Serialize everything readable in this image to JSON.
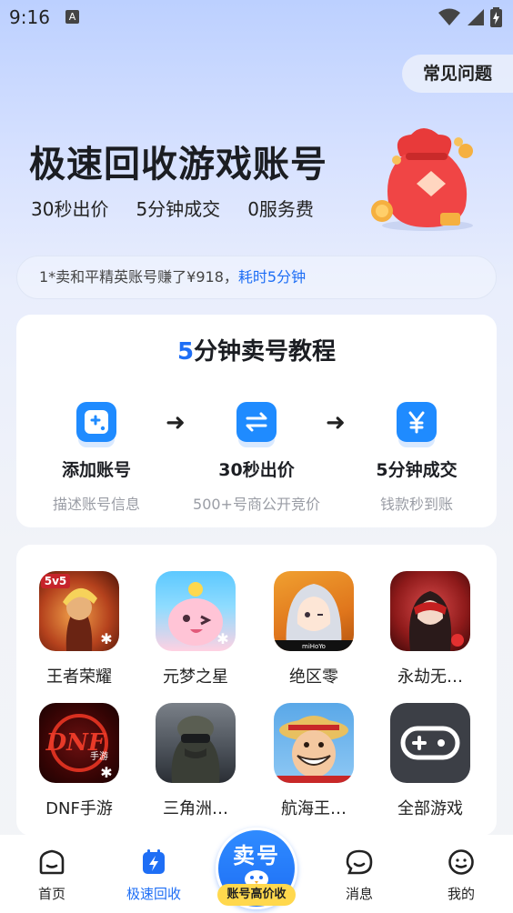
{
  "status": {
    "time": "9:16",
    "indicator": "A"
  },
  "faq_label": "常见问题",
  "hero": {
    "title": "极速回收游戏账号",
    "features": [
      "30秒出价",
      "5分钟成交",
      "0服务费"
    ]
  },
  "ticker": {
    "text": "1*卖和平精英账号赚了¥918，",
    "highlight": "耗时5分钟"
  },
  "tutorial": {
    "title_num": "5",
    "title_rest": "分钟卖号教程",
    "steps": [
      {
        "title": "添加账号",
        "desc": "描述账号信息",
        "icon": "add-icon"
      },
      {
        "title": "30秒出价",
        "desc": "500+号商公开竞价",
        "icon": "swap-icon"
      },
      {
        "title": "5分钟成交",
        "desc": "钱款秒到账",
        "icon": "yen-icon"
      }
    ],
    "arrow": "➜"
  },
  "games": [
    {
      "name": "王者荣耀",
      "badge": "5v5"
    },
    {
      "name": "元梦之星"
    },
    {
      "name": "绝区零",
      "badge": "miHoYo"
    },
    {
      "name": "永劫无…"
    },
    {
      "name": "DNF手游",
      "badge": "手游"
    },
    {
      "name": "三角洲…"
    },
    {
      "name": "航海王…"
    },
    {
      "name": "全部游戏"
    }
  ],
  "tabbar": {
    "tabs": [
      {
        "label": "首页",
        "icon": "home-icon"
      },
      {
        "label": "极速回收",
        "icon": "lightning-icon",
        "active": true
      },
      {
        "label": "消息",
        "icon": "message-icon"
      },
      {
        "label": "我的",
        "icon": "profile-icon"
      }
    ],
    "sell_label": "卖号",
    "sell_badge": "账号高价收"
  },
  "colors": {
    "accent": "#1e6ef5",
    "icon_blue": "#1f8bff",
    "badge_yellow": "#ffd84d"
  }
}
